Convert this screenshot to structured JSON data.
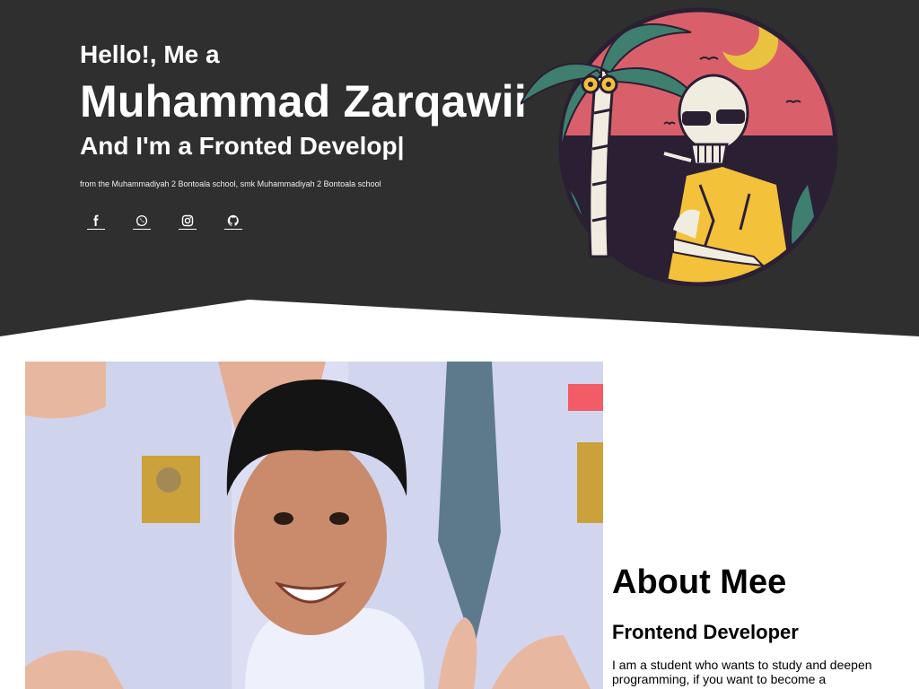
{
  "hero": {
    "greeting": "Hello!, Me a",
    "name": "Muhammad Zarqawii",
    "role_prefix": "And I'm a Fronted Develop",
    "caret": "|",
    "school": "from the Muhammadiyah 2 Bontoala school, smk Muhammadiyah 2 Bontoala school"
  },
  "socials": [
    {
      "icon": "facebook-icon"
    },
    {
      "icon": "whatsapp-icon"
    },
    {
      "icon": "instagram-icon"
    },
    {
      "icon": "github-icon"
    }
  ],
  "about": {
    "title": "About Mee",
    "subtitle": "Frontend Developer",
    "text": "I am a student who wants to study and deepen programming, if you want to become a"
  },
  "colors": {
    "hero_bg": "#2f2f2f",
    "text_light": "#ffffff",
    "sunset_red": "#d9606a",
    "sun_yellow": "#e9c33f",
    "palm_green": "#3e7f6f"
  }
}
